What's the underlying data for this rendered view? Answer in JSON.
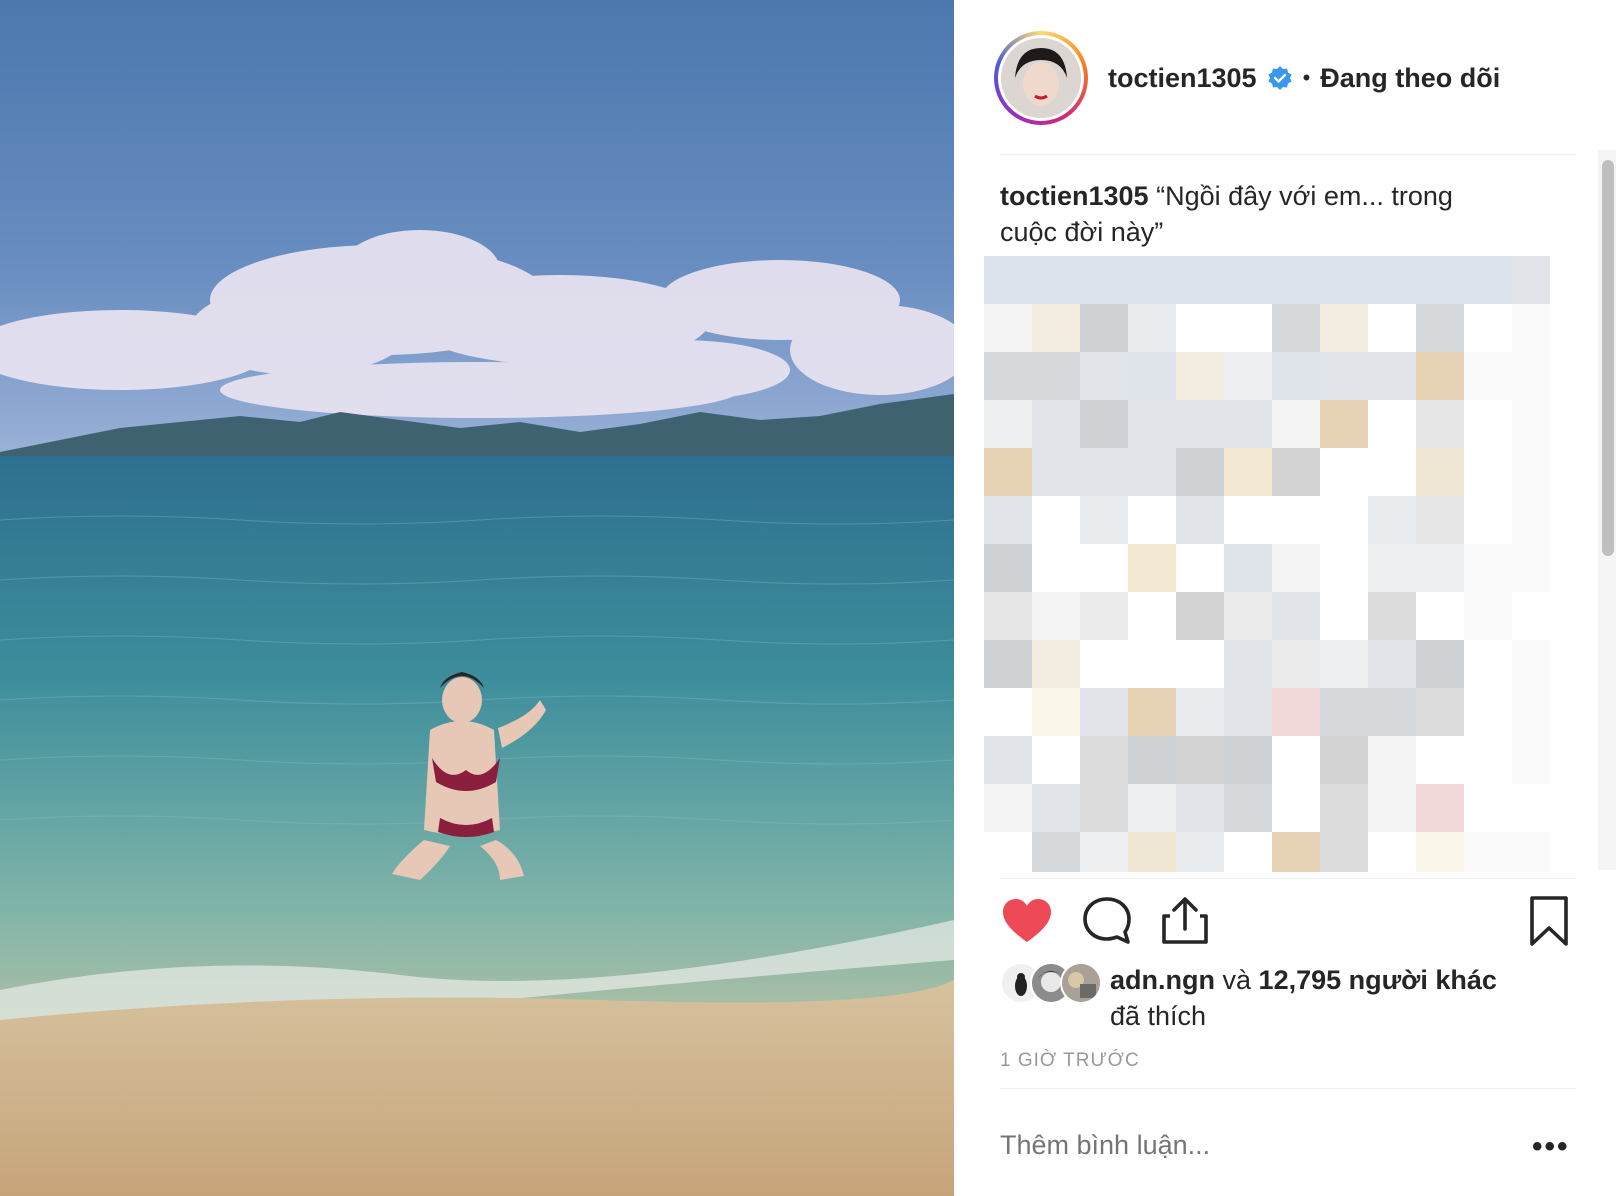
{
  "post": {
    "username": "toctien1305",
    "follow_status": "Đang theo dõi",
    "separator": "•",
    "caption_username": "toctien1305",
    "caption_text": "“Ngồi đây với em... trong cuộc đời này”",
    "liked_by_user": "adn.ngn",
    "likes_conjunction": "và",
    "likes_count_text": "12,795 người khác",
    "likes_suffix": "đã thích",
    "timestamp": "1 GIỜ TRƯỚC",
    "comment_placeholder": "Thêm bình luận...",
    "more_label": "•••"
  },
  "colors": {
    "like_red": "#ed4956",
    "verified_blue": "#3897f0",
    "text_dark": "#262626",
    "text_muted": "#999999"
  },
  "icons": [
    "heart-icon",
    "comment-icon",
    "share-icon",
    "bookmark-icon",
    "verified-icon"
  ]
}
